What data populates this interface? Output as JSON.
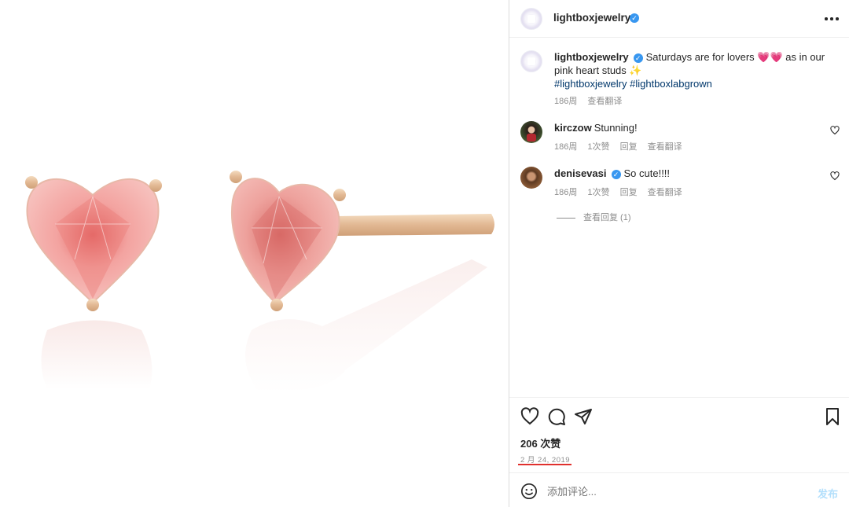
{
  "media": {
    "image_name": "pink-heart-stud-earrings"
  },
  "header": {
    "username": "lightboxjewelry",
    "verified_badge": "✓"
  },
  "caption": {
    "username": "lightboxjewelry",
    "text": "Saturdays are for lovers 💗💗 as in our pink heart studs ✨",
    "hashtags": "#lightboxjewelry #lightboxlabgrown",
    "age": "186周",
    "translate": "查看翻译"
  },
  "comments": [
    {
      "username": "kirczow",
      "text": "Stunning!",
      "age": "186周",
      "likes": "1次赞",
      "reply": "回复",
      "translate": "查看翻译"
    },
    {
      "username": "denisevasi",
      "text": "So cute!!!!",
      "age": "186周",
      "likes": "1次赞",
      "reply": "回复",
      "translate": "查看翻译",
      "verified": "✓"
    }
  ],
  "view_replies": "查看回复 (1)",
  "actions": {
    "like_icon": "heart-icon",
    "comment_icon": "comment-icon",
    "share_icon": "send-icon",
    "save_icon": "bookmark-icon"
  },
  "likes_count": "206 次赞",
  "date": "2 月 24, 2019",
  "comment_input": {
    "placeholder": "添加评论...",
    "post_label": "发布"
  },
  "colors": {
    "accent": "#3897f0",
    "hashtag": "#00376b",
    "muted": "#8e8e8e",
    "underline": "#e0302d"
  }
}
